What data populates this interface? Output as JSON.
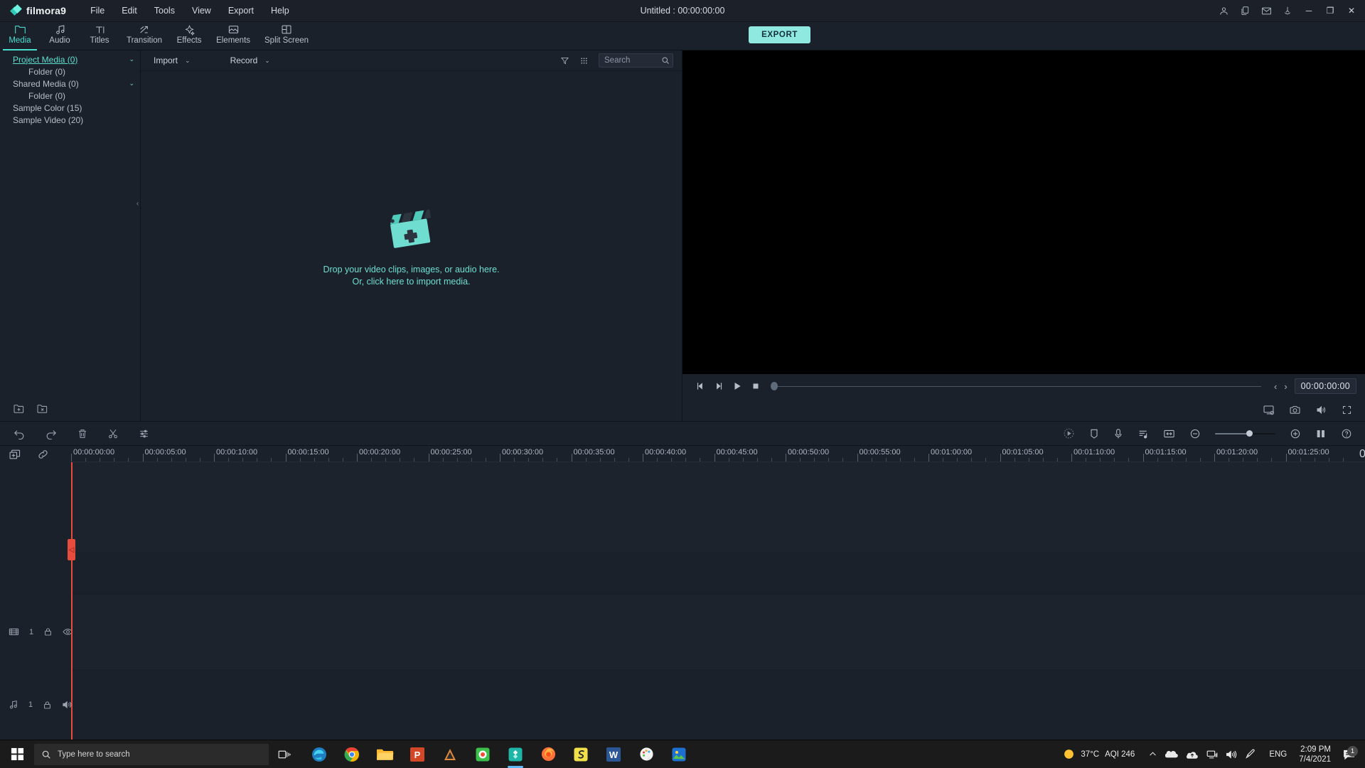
{
  "titlebar": {
    "app_name": "filmora9",
    "window_title": "Untitled : 00:00:00:00",
    "menu": [
      {
        "label": "File"
      },
      {
        "label": "Edit"
      },
      {
        "label": "Tools"
      },
      {
        "label": "View"
      },
      {
        "label": "Export"
      },
      {
        "label": "Help"
      }
    ],
    "right_icons": [
      "account-icon",
      "copy-icon",
      "mail-icon",
      "notification-icon"
    ],
    "window_controls": {
      "minimize": "─",
      "maximize": "❐",
      "close": "✕"
    }
  },
  "ribbon": {
    "tabs": [
      {
        "label": "Media",
        "icon": "folder-icon",
        "active": true
      },
      {
        "label": "Audio",
        "icon": "music-note-icon",
        "active": false
      },
      {
        "label": "Titles",
        "icon": "text-icon",
        "active": false
      },
      {
        "label": "Transition",
        "icon": "transition-arrows-icon",
        "active": false
      },
      {
        "label": "Effects",
        "icon": "sparkle-icon",
        "active": false
      },
      {
        "label": "Elements",
        "icon": "image-icon",
        "active": false
      },
      {
        "label": "Split Screen",
        "icon": "split-screen-icon",
        "active": false
      }
    ],
    "export_label": "EXPORT",
    "export_color": "#8fe9e0"
  },
  "library": {
    "items": [
      {
        "label": "Project Media (0)",
        "selected": true,
        "indent": false,
        "chevron": "⌄"
      },
      {
        "label": "Folder (0)",
        "selected": false,
        "indent": true,
        "chevron": ""
      },
      {
        "label": "Shared Media (0)",
        "selected": false,
        "indent": false,
        "chevron": "⌄"
      },
      {
        "label": "Folder (0)",
        "selected": false,
        "indent": true,
        "chevron": ""
      },
      {
        "label": "Sample Color (15)",
        "selected": false,
        "indent": false,
        "chevron": ""
      },
      {
        "label": "Sample Video (20)",
        "selected": false,
        "indent": false,
        "chevron": ""
      }
    ],
    "bottom_icons": [
      "new-folder-icon",
      "delete-folder-icon"
    ],
    "collapse_handle": "‹"
  },
  "media_panel": {
    "import_label": "Import",
    "record_label": "Record",
    "dropdown_caret": "⌄",
    "filter_icon": "filter-icon",
    "grid_icon": "grid-view-icon",
    "search_placeholder": "Search",
    "search_value": "",
    "search_icon": "search-icon",
    "dropzone_line1": "Drop your video clips, images, or audio here.",
    "dropzone_line2": "Or, click here to import media.",
    "dropzone_color": "#6ddfd2",
    "clapper_icon": "clapperboard-plus-icon"
  },
  "preview": {
    "controls": [
      {
        "icon": "previous-frame-icon"
      },
      {
        "icon": "next-frame-icon"
      },
      {
        "icon": "play-icon"
      },
      {
        "icon": "stop-icon"
      }
    ],
    "mark_in": "‹",
    "mark_out": "›",
    "timecode": "00:00:00:00",
    "bottom_icons": [
      "snapshot-device-icon",
      "camera-icon",
      "volume-icon",
      "fullscreen-icon"
    ]
  },
  "timeline": {
    "toolbar_left": [
      "undo-icon",
      "redo-icon",
      "delete-icon",
      "split-scissors-icon",
      "adjust-sliders-icon"
    ],
    "toolbar_right": [
      "render-preview-icon",
      "marker-icon",
      "voiceover-mic-icon",
      "audio-list-icon",
      "fit-timeline-icon",
      "zoom-out-icon",
      "zoom-slider",
      "zoom-in-icon",
      "split-view-icon",
      "help-icon"
    ],
    "head_icons": [
      "add-track-icon",
      "link-icon"
    ],
    "ruler_marks": [
      "00:00:00:00",
      "00:00:05:00",
      "00:00:10:00",
      "00:00:15:00",
      "00:00:20:00",
      "00:00:25:00",
      "00:00:30:00",
      "00:00:35:00",
      "00:00:40:00",
      "00:00:45:00",
      "00:00:50:00",
      "00:00:55:00",
      "00:01:00:00",
      "00:01:05:00",
      "00:01:10:00",
      "00:01:15:00",
      "00:01:20:00",
      "00:01:25:00"
    ],
    "ruler_end_label": "0",
    "tracks": [
      {
        "type": "video",
        "number": "1",
        "icons": [
          "track-video-icon",
          "lock-icon",
          "eye-icon"
        ]
      },
      {
        "type": "audio",
        "number": "1",
        "icons": [
          "track-audio-icon",
          "lock-icon",
          "speaker-icon"
        ]
      }
    ],
    "playhead_color": "#e84c3d"
  },
  "taskbar": {
    "search_placeholder": "Type here to search",
    "start_icon": "windows-start-icon",
    "search_icon": "search-icon",
    "taskview_icon": "task-view-icon",
    "apps": [
      {
        "name": "edge-icon"
      },
      {
        "name": "chrome-icon"
      },
      {
        "name": "file-explorer-icon"
      },
      {
        "name": "powerpoint-icon"
      },
      {
        "name": "autodesk-icon"
      },
      {
        "name": "camtasia-icon"
      },
      {
        "name": "filmora-icon",
        "active": true
      },
      {
        "name": "firefox-icon"
      },
      {
        "name": "snagit-icon"
      },
      {
        "name": "word-icon"
      },
      {
        "name": "paint-icon"
      },
      {
        "name": "photos-icon"
      }
    ],
    "temperature": "37°C",
    "aqi": "AQI 246",
    "tray_icons": [
      "chevron-up-icon",
      "onedrive-icon",
      "cloud-upload-icon",
      "network-icon",
      "volume-icon",
      "pen-icon"
    ],
    "language": "ENG",
    "time": "2:09 PM",
    "date": "7/4/2021",
    "notification_icon": "notification-icon",
    "notification_count": "1"
  }
}
